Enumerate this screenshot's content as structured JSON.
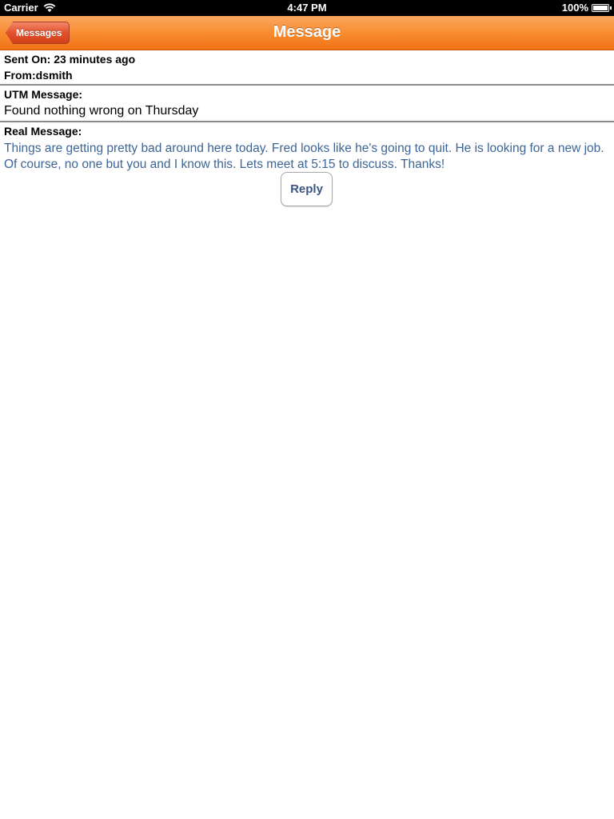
{
  "status_bar": {
    "carrier": "Carrier",
    "time": "4:47 PM",
    "battery": "100%"
  },
  "nav": {
    "back_label": "Messages",
    "title": "Message"
  },
  "message": {
    "sent_on": "Sent On: 23 minutes ago",
    "from": "From:dsmith",
    "utm_label": "UTM Message:",
    "utm_text": "Found nothing wrong on Thursday",
    "real_label": "Real Message:",
    "real_text": "Things are getting pretty bad around here today.  Fred looks like he's going to quit. He is looking for a new job.  Of course, no one but you and I know this. Lets meet at 5:15 to discuss. Thanks!"
  },
  "actions": {
    "reply_label": "Reply"
  },
  "colors": {
    "nav_orange": "#f98d32",
    "back_button_red": "#e2522d",
    "message_blue": "#3d6596"
  }
}
